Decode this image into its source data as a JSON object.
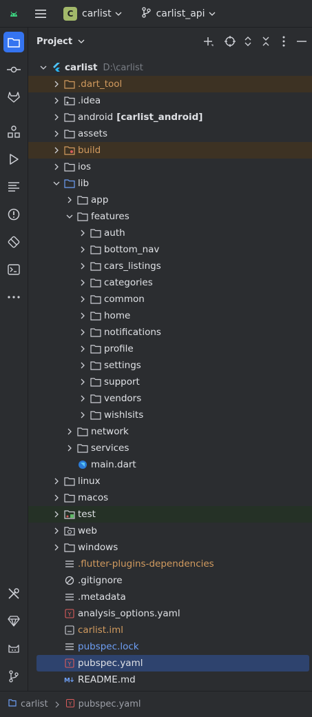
{
  "titlebar": {
    "project_badge": "C",
    "project_name": "carlist",
    "branch_name": "carlist_api"
  },
  "panel": {
    "title": "Project"
  },
  "tree": {
    "root": {
      "name": "carlist",
      "path": "D:\\carlist"
    },
    "items": [
      {
        "label": ".dart_tool"
      },
      {
        "label": ".idea"
      },
      {
        "label": "android",
        "suffix": "[carlist_android]"
      },
      {
        "label": "assets"
      },
      {
        "label": "build"
      },
      {
        "label": "ios"
      },
      {
        "label": "lib"
      },
      {
        "label": "app"
      },
      {
        "label": "features"
      },
      {
        "label": "auth"
      },
      {
        "label": "bottom_nav"
      },
      {
        "label": "cars_listings"
      },
      {
        "label": "categories"
      },
      {
        "label": "common"
      },
      {
        "label": "home"
      },
      {
        "label": "notifications"
      },
      {
        "label": "profile"
      },
      {
        "label": "settings"
      },
      {
        "label": "support"
      },
      {
        "label": "vendors"
      },
      {
        "label": "wishlsits"
      },
      {
        "label": "network"
      },
      {
        "label": "services"
      },
      {
        "label": "main.dart"
      },
      {
        "label": "linux"
      },
      {
        "label": "macos"
      },
      {
        "label": "test"
      },
      {
        "label": "web"
      },
      {
        "label": "windows"
      },
      {
        "label": ".flutter-plugins-dependencies"
      },
      {
        "label": ".gitignore"
      },
      {
        "label": ".metadata"
      },
      {
        "label": "analysis_options.yaml"
      },
      {
        "label": "carlist.iml"
      },
      {
        "label": "pubspec.lock"
      },
      {
        "label": "pubspec.yaml"
      },
      {
        "label": "README.md"
      }
    ]
  },
  "statusbar": {
    "crumb_project": "carlist",
    "crumb_file": "pubspec.yaml"
  },
  "colors": {
    "accent": "#3574f0",
    "excluded_folder": "#d29b5f",
    "vcs_modified": "#6e9ff5",
    "selection": "#2e436e"
  }
}
